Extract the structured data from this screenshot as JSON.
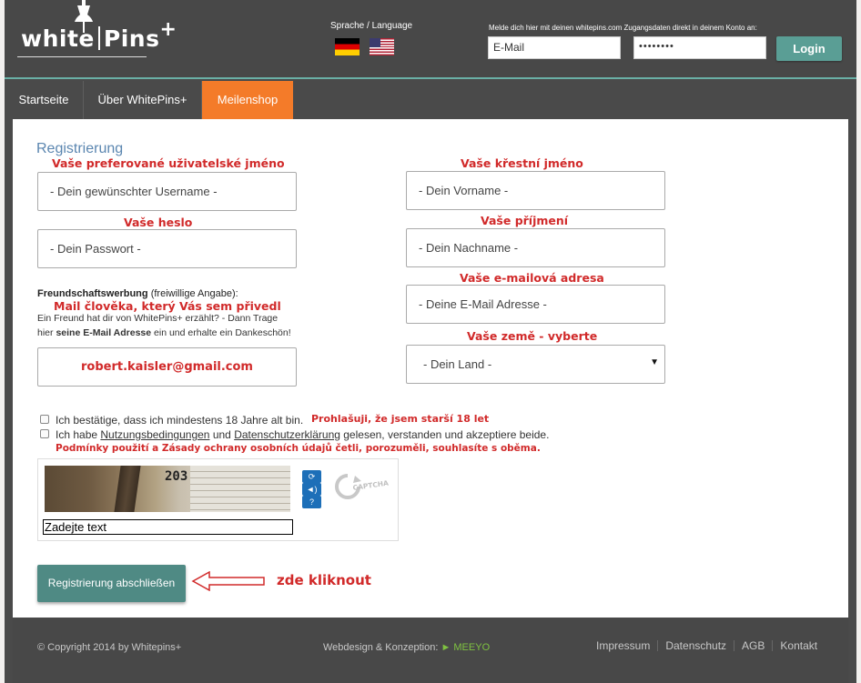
{
  "brand": {
    "logo_text": "white",
    "logo_text2": "Pins",
    "logo_plus": "+"
  },
  "header": {
    "language_label": "Sprache / Language",
    "flags": [
      "flag-de-icon",
      "flag-us-icon"
    ],
    "login_hint": "Melde dich hier mit deinen whitepins.com Zugangsdaten direkt in deinem Konto an:",
    "email_value": "E-Mail",
    "password_value": "••••••••",
    "login_button": "Login"
  },
  "nav": {
    "items": [
      "Startseite",
      "Über WhitePins+",
      "Meilenshop"
    ],
    "active_index": 2
  },
  "form": {
    "heading": "Registrierung",
    "username_annot": "Vaše preferované uživatelské jméno",
    "username_placeholder": "- Dein gewünschter Username -",
    "firstname_annot": "Vaše křestní jméno",
    "firstname_placeholder": "- Dein Vorname -",
    "password_annot": "Vaše heslo",
    "password_placeholder": "- Dein Passwort -",
    "lastname_annot": "Vaše příjmení",
    "lastname_placeholder": "- Dein Nachname -",
    "email_annot": "Vaše e-mailová adresa",
    "email_placeholder": "- Deine E-Mail Adresse -",
    "referral_title": "Freundschaftswerbung",
    "referral_optional": "(freiwillige Angabe):",
    "referral_annot": "Mail člověka, který Vás sem přivedl",
    "referral_text1": "Ein Freund hat dir von WhitePins+ erzählt? - Dann Trage",
    "referral_text2_pre": "hier ",
    "referral_text2_bold": "seine E-Mail Adresse",
    "referral_text2_post": " ein und erhalte ein Dankeschön!",
    "referral_value": "robert.kaisler@gmail.com",
    "country_annot": "Vaše země - vyberte",
    "country_selected": "- Dein Land -",
    "check_age_text": "Ich bestätige, dass ich mindestens 18 Jahre alt bin.",
    "check_age_annot": "Prohlašuji, že jsem starší 18 let",
    "check_terms_pre": "Ich habe ",
    "check_terms_link1": "Nutzungsbedingungen",
    "check_terms_mid": " und ",
    "check_terms_link2": "Datenschutzerklärung",
    "check_terms_post": " gelesen, verstanden und akzeptiere beide.",
    "check_terms_annot": "Podmínky použití a Zásady ochrany osobních údajů četli, porozuměli, souhlasíte s oběma.",
    "captcha_number": "203",
    "captcha_input_value": "Zadejte text",
    "captcha_logo": "CAPTCHA",
    "submit_label": "Registrierung abschließen",
    "submit_annot": "zde kliknout"
  },
  "footer": {
    "copyright": "© Copyright 2014 by Whitepins+",
    "credit_label": "Webdesign & Konzeption:",
    "credit_name": "► MEEYO",
    "links": [
      "Impressum",
      "Datenschutz",
      "AGB",
      "Kontakt"
    ]
  },
  "colors": {
    "accent_orange": "#f47b29",
    "teal": "#5a9e95",
    "annotation_red": "#d12a2a",
    "heading_blue": "#5b86b0"
  }
}
